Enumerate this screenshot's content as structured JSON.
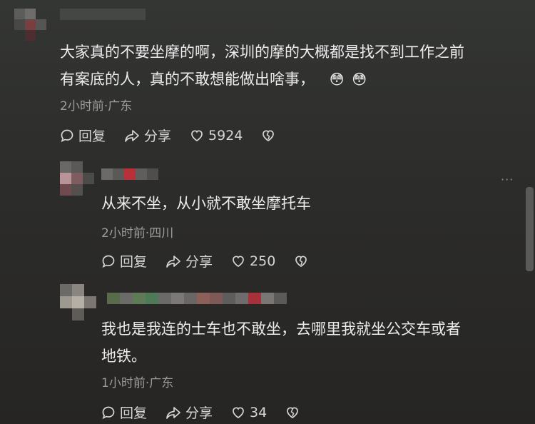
{
  "comments": [
    {
      "text_line1": "大家真的不要坐摩的啊，深圳的摩的大概都是找不到工作之前",
      "text_line2": "有案底的人，真的不敢想能做出啥事，",
      "emoji": "😳",
      "meta": "2小时前·广东",
      "reply_label": "回复",
      "share_label": "分享",
      "likes": "5924"
    },
    {
      "text_line1": "从来不坐，从小就不敢坐摩托车",
      "meta": "2小时前·四川",
      "reply_label": "回复",
      "share_label": "分享",
      "likes": "250",
      "more": "···"
    },
    {
      "text_line1": "我也是我连的士车也不敢坐，去哪里我就坐公交车或者",
      "text_line2": "地铁。",
      "meta": "1小时前·广东",
      "reply_label": "回复",
      "share_label": "分享",
      "likes": "34"
    }
  ],
  "icons": {
    "reply": "speech-bubble-icon",
    "share": "share-arrow-icon",
    "like": "heart-icon",
    "dislike": "broken-heart-icon"
  }
}
